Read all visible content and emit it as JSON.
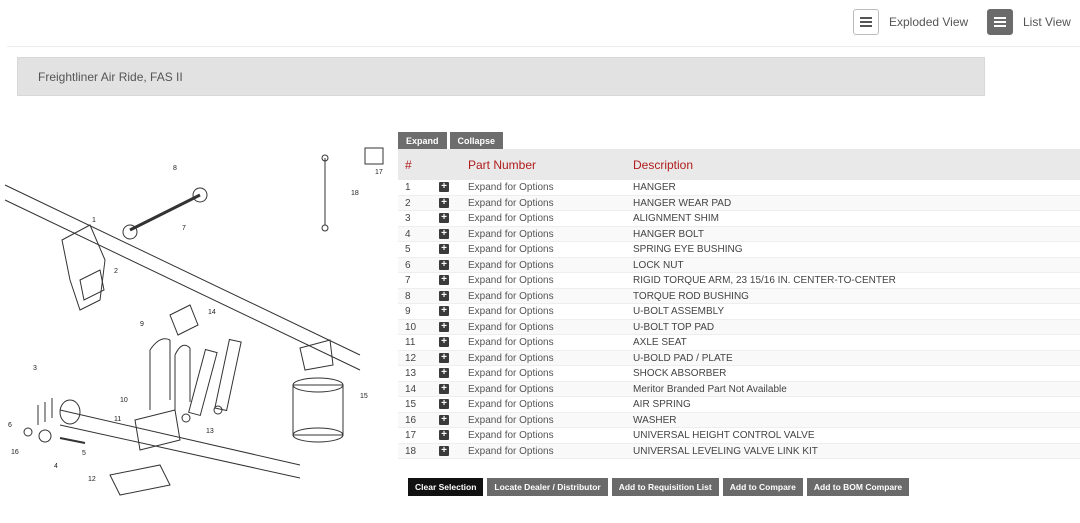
{
  "header": {
    "exploded_label": "Exploded View",
    "list_label": "List View"
  },
  "title": "Freightliner Air Ride, FAS II",
  "tabs": {
    "expand": "Expand",
    "collapse": "Collapse"
  },
  "table": {
    "col_num": "#",
    "col_part": "Part Number",
    "col_desc": "Description",
    "rows": [
      {
        "num": "1",
        "part": "Expand for Options",
        "desc": "HANGER"
      },
      {
        "num": "2",
        "part": "Expand for Options",
        "desc": "HANGER WEAR PAD"
      },
      {
        "num": "3",
        "part": "Expand for Options",
        "desc": "ALIGNMENT SHIM"
      },
      {
        "num": "4",
        "part": "Expand for Options",
        "desc": "HANGER BOLT"
      },
      {
        "num": "5",
        "part": "Expand for Options",
        "desc": "SPRING EYE BUSHING"
      },
      {
        "num": "6",
        "part": "Expand for Options",
        "desc": "LOCK NUT"
      },
      {
        "num": "7",
        "part": "Expand for Options",
        "desc": "RIGID TORQUE ARM, 23 15/16 IN. CENTER-TO-CENTER"
      },
      {
        "num": "8",
        "part": "Expand for Options",
        "desc": "TORQUE ROD BUSHING"
      },
      {
        "num": "9",
        "part": "Expand for Options",
        "desc": "U-BOLT ASSEMBLY"
      },
      {
        "num": "10",
        "part": "Expand for Options",
        "desc": "U-BOLT TOP PAD"
      },
      {
        "num": "11",
        "part": "Expand for Options",
        "desc": "AXLE SEAT"
      },
      {
        "num": "12",
        "part": "Expand for Options",
        "desc": "U-BOLD PAD / PLATE"
      },
      {
        "num": "13",
        "part": "Expand for Options",
        "desc": "SHOCK ABSORBER"
      },
      {
        "num": "14",
        "part": "Expand for Options",
        "desc": "Meritor Branded Part Not Available"
      },
      {
        "num": "15",
        "part": "Expand for Options",
        "desc": "AIR SPRING"
      },
      {
        "num": "16",
        "part": "Expand for Options",
        "desc": "WASHER"
      },
      {
        "num": "17",
        "part": "Expand for Options",
        "desc": "UNIVERSAL HEIGHT CONTROL VALVE"
      },
      {
        "num": "18",
        "part": "Expand for Options",
        "desc": "UNIVERSAL LEVELING VALVE LINK KIT"
      }
    ]
  },
  "actions": {
    "clear": "Clear Selection",
    "locate": "Locate Dealer / Distributor",
    "requisition": "Add to Requisition List",
    "compare": "Add to Compare",
    "bom": "Add to BOM Compare"
  },
  "diagram_callouts": [
    "1",
    "2",
    "3",
    "4",
    "5",
    "6",
    "7",
    "8",
    "9",
    "10",
    "11",
    "12",
    "13",
    "14",
    "15",
    "16",
    "17",
    "18"
  ]
}
